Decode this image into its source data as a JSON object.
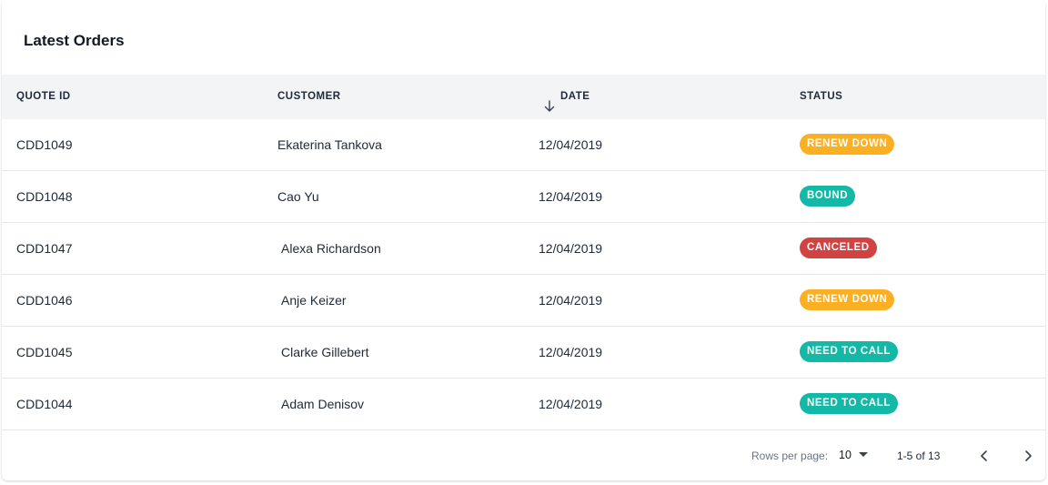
{
  "card": {
    "title": "Latest Orders"
  },
  "table": {
    "columns": {
      "quote_id": "QUOTE ID",
      "customer": "CUSTOMER",
      "date": "DATE",
      "status": "STATUS"
    },
    "sort": {
      "column": "date",
      "direction": "desc",
      "icon": "arrow-down-icon"
    },
    "rows": [
      {
        "quote_id": "CDD1049",
        "customer": "Ekaterina Tankova",
        "date": "12/04/2019",
        "status": "RENEW DOWN",
        "status_color": "#fbb024"
      },
      {
        "quote_id": "CDD1048",
        "customer": "Cao Yu",
        "date": "12/04/2019",
        "status": "BOUND",
        "status_color": "#14b8a6"
      },
      {
        "quote_id": "CDD1047",
        "customer": "Alexa Richardson",
        "date": "12/04/2019",
        "status": "CANCELED",
        "status_color": "#d14343"
      },
      {
        "quote_id": "CDD1046",
        "customer": "Anje Keizer",
        "date": "12/04/2019",
        "status": "RENEW DOWN",
        "status_color": "#fbb024"
      },
      {
        "quote_id": "CDD1045",
        "customer": "Clarke Gillebert",
        "date": "12/04/2019",
        "status": "NEED TO CALL",
        "status_color": "#14b8a6"
      },
      {
        "quote_id": "CDD1044",
        "customer": "Adam Denisov",
        "date": "12/04/2019",
        "status": "NEED TO CALL",
        "status_color": "#14b8a6"
      }
    ]
  },
  "pagination": {
    "rows_per_page_label": "Rows per page:",
    "rows_per_page_value": "10",
    "range_text": "1-5 of 13",
    "prev_icon": "chevron-left-icon",
    "next_icon": "chevron-right-icon"
  }
}
